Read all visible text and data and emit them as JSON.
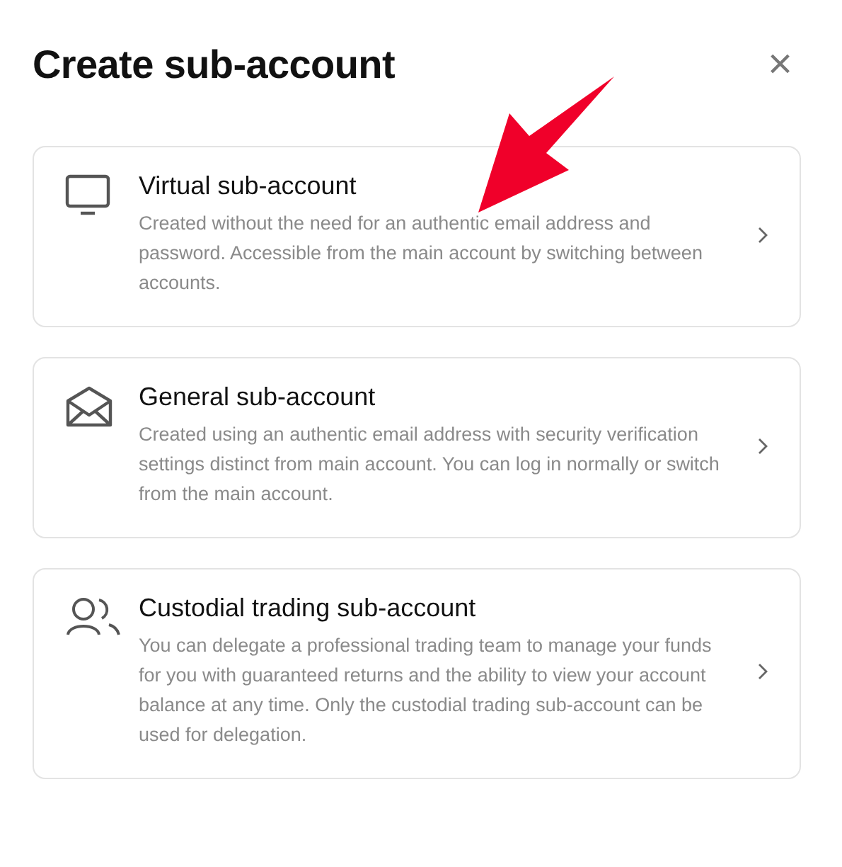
{
  "dialog": {
    "title": "Create sub-account",
    "close": "×"
  },
  "options": [
    {
      "kind": "monitor",
      "title": "Virtual sub-account",
      "description": "Created without the need for an authentic email address and password. Accessible from the main account by switching between accounts."
    },
    {
      "kind": "envelope",
      "title": "General sub-account",
      "description": "Created using an authentic email address with security verification settings distinct from main account. You can log in normally or switch from the main account."
    },
    {
      "kind": "users",
      "title": "Custodial trading sub-account",
      "description": "You can delegate a professional trading team to manage your funds for you with guaranteed returns and the ability to view your account balance at any time. Only the custodial trading sub-account can be used for delegation."
    }
  ]
}
